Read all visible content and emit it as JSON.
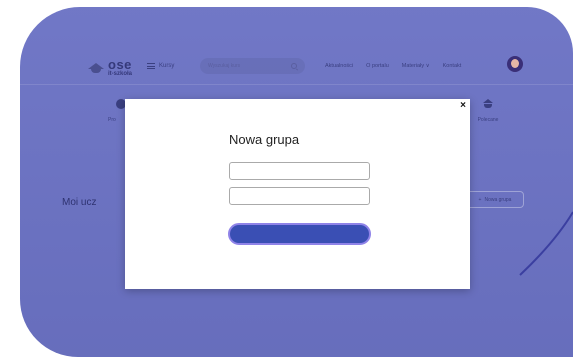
{
  "header": {
    "logo_main": "ose",
    "logo_sub": "it-szkoła",
    "kursy_label": "Kursy",
    "search_placeholder": "Wyszukaj kurs",
    "nav": [
      "Aktualności",
      "O portalu",
      "Materiały ∨",
      "Kontakt"
    ]
  },
  "tiles": {
    "left_label": "Pro",
    "right_label": "Polecane"
  },
  "page": {
    "heading_partial": "Moi ucz",
    "new_group_button": "Nowa grupa"
  },
  "modal": {
    "title": "Nowa grupa",
    "close_symbol": "×",
    "field1_value": "",
    "field2_value": "",
    "submit_label": ""
  },
  "colors": {
    "backdrop": "#6b72c4",
    "submit": "#3a4fb4",
    "submit_border": "#8f83e8"
  }
}
